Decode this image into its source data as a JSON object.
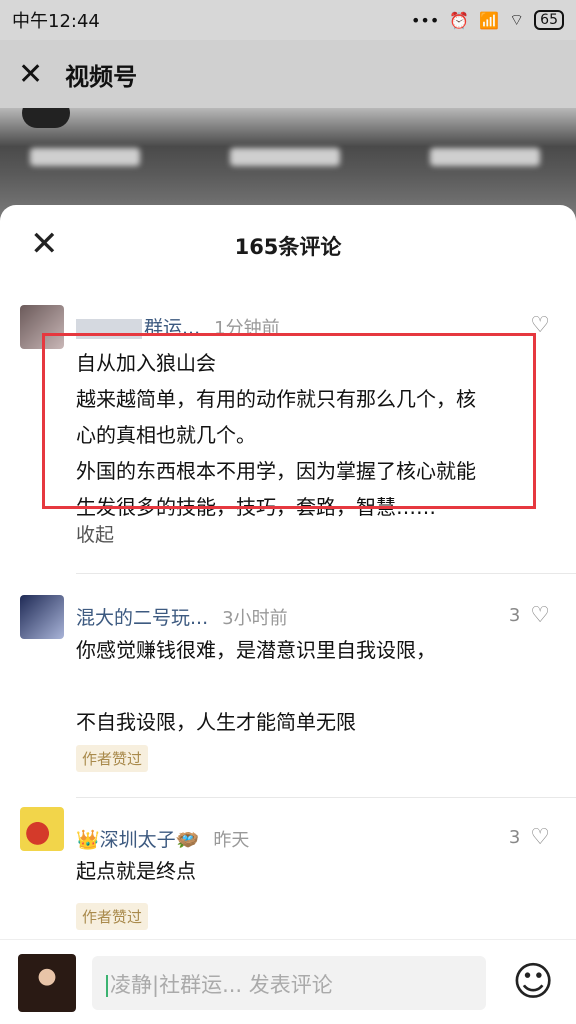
{
  "status_bar": {
    "time": "中午12:44",
    "signal": "📶",
    "wifi": "⌔",
    "battery": "65"
  },
  "app_header": {
    "title": "视频号"
  },
  "sheet": {
    "title": "165条评论"
  },
  "comments": [
    {
      "username": "群运...",
      "time": "1分钟前",
      "lines": [
        "自从加入狼山会",
        "越来越简单，有用的动作就只有那么几个，核",
        "心的真相也就几个。",
        "外国的东西根本不用学，因为掌握了核心就能",
        "生发很多的技能，技巧，套路，智慧……"
      ],
      "collapse_label": "收起"
    },
    {
      "username": "混大的二号玩...",
      "time": "3小时前",
      "likes": "3",
      "lines": [
        "你感觉赚钱很难，是潜意识里自我设限，",
        "",
        "不自我设限，人生才能简单无限"
      ],
      "badge": "作者赞过"
    },
    {
      "username": "👑深圳太子🪺",
      "time": "昨天",
      "likes": "3",
      "lines": [
        "起点就是终点"
      ],
      "badge": "作者赞过"
    }
  ],
  "input": {
    "placeholder": "凌静|社群运... 发表评论"
  },
  "colors": {
    "highlight": "#e6383f",
    "username": "#3d5a80",
    "badge_bg": "#f7efde"
  }
}
